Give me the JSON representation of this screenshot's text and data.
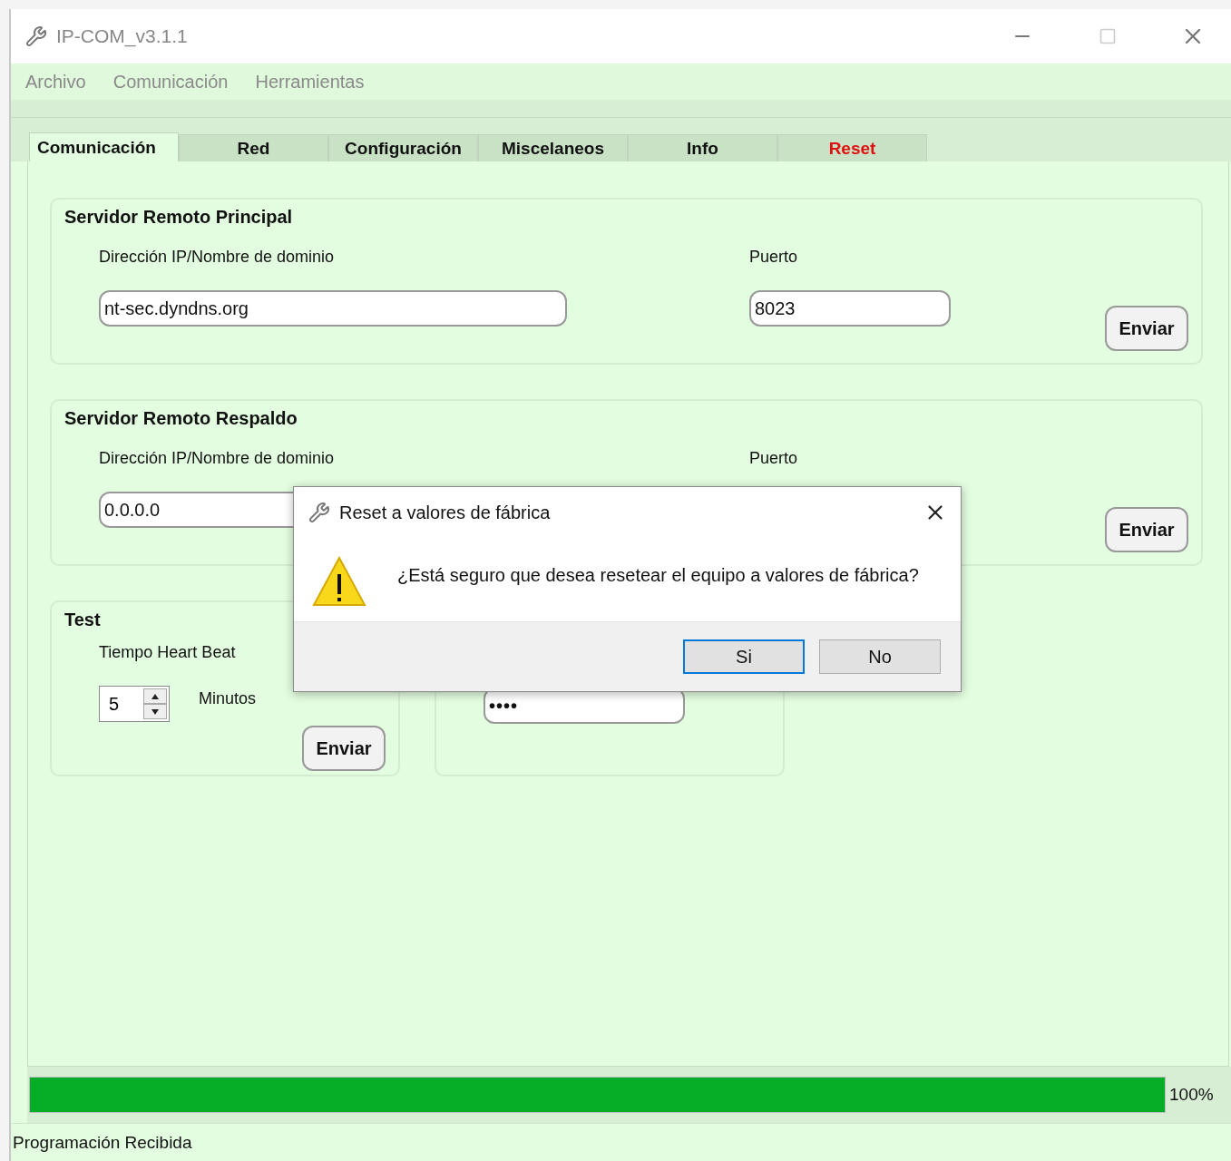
{
  "window": {
    "title": "IP-COM_v3.1.1"
  },
  "menu": [
    "Archivo",
    "Comunicación",
    "Herramientas"
  ],
  "tabs": [
    {
      "label": "Comunicación",
      "selected": true,
      "kind": "normal"
    },
    {
      "label": "Red",
      "selected": false,
      "kind": "normal"
    },
    {
      "label": "Configuración",
      "selected": false,
      "kind": "normal"
    },
    {
      "label": "Miscelaneos",
      "selected": false,
      "kind": "normal"
    },
    {
      "label": "Info",
      "selected": false,
      "kind": "normal"
    },
    {
      "label": "Reset",
      "selected": false,
      "kind": "danger"
    }
  ],
  "servers": [
    {
      "title": "Servidor Remoto Principal",
      "ip_label": "Dirección IP/Nombre de dominio",
      "ip_value": "nt-sec.dyndns.org",
      "port_label": "Puerto",
      "port_value": "8023",
      "button": "Enviar"
    },
    {
      "title": "Servidor Remoto Respaldo",
      "ip_label": "Dirección IP/Nombre de dominio",
      "ip_value": "0.0.0.0",
      "port_label": "Puerto",
      "button": "Enviar"
    }
  ],
  "test": {
    "title": "Test",
    "label": "Tiempo Heart Beat",
    "value": "5",
    "unit": "Minutos",
    "button": "Enviar"
  },
  "password_panel": {
    "value": "••••"
  },
  "progress": {
    "level": 1,
    "reading": "100%"
  },
  "status_bar": "Programación Recibida",
  "dialog": {
    "title": "Reset a valores de fábrica",
    "message": "¿Está seguro que desea resetear el equipo a valores de fábrica?",
    "buttons": [
      {
        "label": "Si",
        "selected": true
      },
      {
        "label": "No",
        "selected": false
      }
    ]
  }
}
